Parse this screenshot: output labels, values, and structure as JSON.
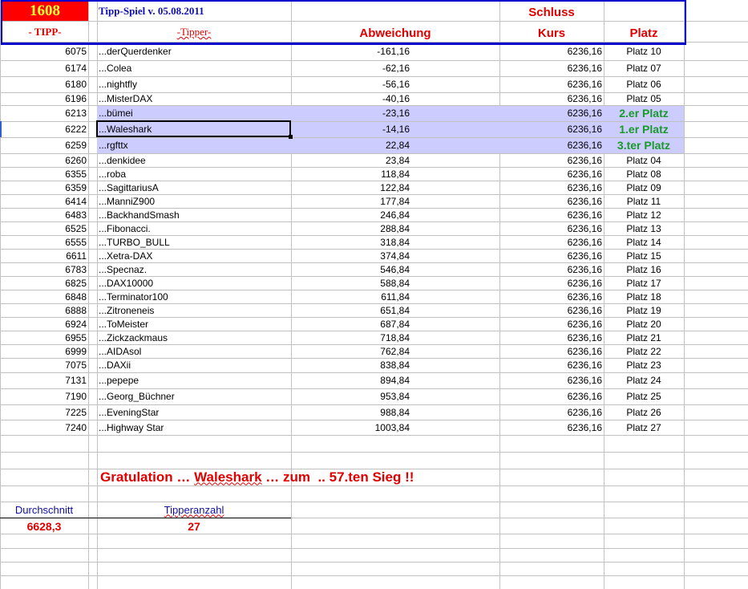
{
  "header": {
    "tip_number": "1608",
    "title": "Tipp-Spiel v. 05.08.2011",
    "col_tipp": "- TIPP-",
    "col_tipper": "-Tipper-",
    "col_abweichung": "Abweichung",
    "col_schluss": "Schluss",
    "col_kurs": "Kurs",
    "col_platz": "Platz"
  },
  "rows": [
    {
      "tipp": "6075",
      "tipper": "...derQuerdenker",
      "abw": "-161,16",
      "kurs": "6236,16",
      "platz": "Platz 10"
    },
    {
      "tipp": "6174",
      "tipper": "...Colea",
      "abw": "-62,16",
      "kurs": "6236,16",
      "platz": "Platz 07"
    },
    {
      "tipp": "6180",
      "tipper": "...nightfly",
      "abw": "-56,16",
      "kurs": "6236,16",
      "platz": "Platz 06"
    },
    {
      "tipp": "6196",
      "tipper": "...MisterDAX",
      "abw": "-40,16",
      "kurs": "6236,16",
      "platz": "Platz 05"
    },
    {
      "tipp": "6213",
      "tipper": "...bümei",
      "abw": "-23,16",
      "kurs": "6236,16",
      "platz": "2.er Platz",
      "podium": true
    },
    {
      "tipp": "6222",
      "tipper": "...Waleshark",
      "abw": "-14,16",
      "kurs": "6236,16",
      "platz": "1.er Platz",
      "podium": true,
      "selected": true
    },
    {
      "tipp": "6259",
      "tipper": "...rgfttx",
      "abw": "22,84",
      "kurs": "6236,16",
      "platz": "3.ter Platz",
      "podium": true
    },
    {
      "tipp": "6260",
      "tipper": "...denkidee",
      "abw": "23,84",
      "kurs": "6236,16",
      "platz": "Platz 04"
    },
    {
      "tipp": "6355",
      "tipper": "...roba",
      "abw": "118,84",
      "kurs": "6236,16",
      "platz": "Platz 08"
    },
    {
      "tipp": "6359",
      "tipper": "...SagittariusA",
      "abw": "122,84",
      "kurs": "6236,16",
      "platz": "Platz 09"
    },
    {
      "tipp": "6414",
      "tipper": "...ManniZ900",
      "abw": "177,84",
      "kurs": "6236,16",
      "platz": "Platz 11"
    },
    {
      "tipp": "6483",
      "tipper": "...BackhandSmash",
      "abw": "246,84",
      "kurs": "6236,16",
      "platz": "Platz 12"
    },
    {
      "tipp": "6525",
      "tipper": "...Fibonacci.",
      "abw": "288,84",
      "kurs": "6236,16",
      "platz": "Platz 13"
    },
    {
      "tipp": "6555",
      "tipper": "...TURBO_BULL",
      "abw": "318,84",
      "kurs": "6236,16",
      "platz": "Platz 14"
    },
    {
      "tipp": "6611",
      "tipper": "...Xetra-DAX",
      "abw": "374,84",
      "kurs": "6236,16",
      "platz": "Platz 15"
    },
    {
      "tipp": "6783",
      "tipper": "...Specnaz.",
      "abw": "546,84",
      "kurs": "6236,16",
      "platz": "Platz 16"
    },
    {
      "tipp": "6825",
      "tipper": "...DAX10000",
      "abw": "588,84",
      "kurs": "6236,16",
      "platz": "Platz 17"
    },
    {
      "tipp": "6848",
      "tipper": "...Terminator100",
      "abw": "611,84",
      "kurs": "6236,16",
      "platz": "Platz 18"
    },
    {
      "tipp": "6888",
      "tipper": "...Zitroneneis",
      "abw": "651,84",
      "kurs": "6236,16",
      "platz": "Platz 19"
    },
    {
      "tipp": "6924",
      "tipper": "...ToMeister",
      "abw": "687,84",
      "kurs": "6236,16",
      "platz": "Platz 20"
    },
    {
      "tipp": "6955",
      "tipper": "...Zickzackmaus",
      "abw": "718,84",
      "kurs": "6236,16",
      "platz": "Platz 21"
    },
    {
      "tipp": "6999",
      "tipper": "...AIDAsol",
      "abw": "762,84",
      "kurs": "6236,16",
      "platz": "Platz 22"
    },
    {
      "tipp": "7075",
      "tipper": "...DAXii",
      "abw": "838,84",
      "kurs": "6236,16",
      "platz": "Platz 23"
    },
    {
      "tipp": "7131",
      "tipper": "...pepepe",
      "abw": "894,84",
      "kurs": "6236,16",
      "platz": "Platz 24"
    },
    {
      "tipp": "7190",
      "tipper": "...Georg_Büchner",
      "abw": "953,84",
      "kurs": "6236,16",
      "platz": "Platz 25"
    },
    {
      "tipp": "7225",
      "tipper": "...EveningStar",
      "abw": "988,84",
      "kurs": "6236,16",
      "platz": "Platz 26"
    },
    {
      "tipp": "7240",
      "tipper": "...Highway Star",
      "abw": "1003,84",
      "kurs": "6236,16",
      "platz": "Platz 27"
    }
  ],
  "footer": {
    "congrats_prefix": "Gratulation … ",
    "congrats_name": "Waleshark",
    "congrats_suffix": " … zum  .. 57.ten Sieg !!",
    "avg_label": "Durchschnitt",
    "avg_value": "6628,3",
    "count_label": "Tipperanzahl",
    "count_value": "27"
  },
  "colors": {
    "accent_red": "#e00000",
    "header_blue": "#0000cc",
    "highlight": "#ccccff",
    "podium_green": "#1a9a2a",
    "tip_bg": "#ff0000",
    "tip_fg": "#ffff33"
  }
}
